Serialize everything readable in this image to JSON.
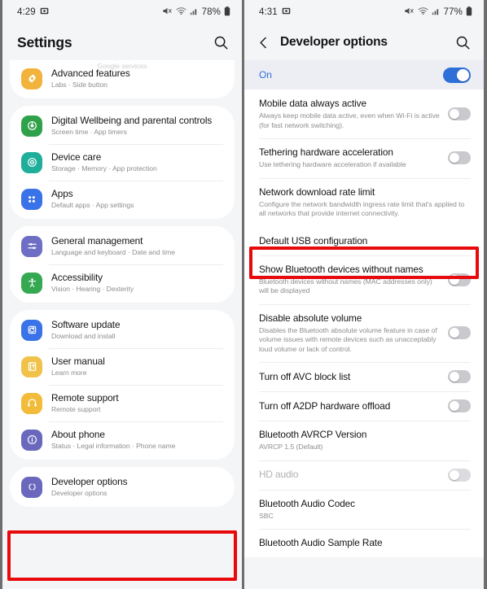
{
  "left": {
    "status": {
      "time": "4:29",
      "battery": "78%",
      "icons": [
        "mute-icon",
        "wifi-icon",
        "signal-icon",
        "battery-icon",
        "screenshot-icon"
      ]
    },
    "header": {
      "title": "Settings",
      "search_icon": "search-icon"
    },
    "ghost_item": "Google services",
    "groups": [
      {
        "clipped": true,
        "items": [
          {
            "title": "Advanced features",
            "sub": "Labs  ·  Side button",
            "icon": "advanced-features-icon",
            "color": "#f2b33d"
          }
        ]
      },
      {
        "clipped": false,
        "items": [
          {
            "title": "Digital Wellbeing and parental controls",
            "sub": "Screen time  ·  App timers",
            "icon": "digital-wellbeing-icon",
            "color": "#2fa14a"
          },
          {
            "title": "Device care",
            "sub": "Storage  ·  Memory  ·  App protection",
            "icon": "device-care-icon",
            "color": "#1fae9a"
          },
          {
            "title": "Apps",
            "sub": "Default apps  ·  App settings",
            "icon": "apps-icon",
            "color": "#3a72e8"
          }
        ]
      },
      {
        "clipped": false,
        "items": [
          {
            "title": "General management",
            "sub": "Language and keyboard  ·  Date and time",
            "icon": "general-management-icon",
            "color": "#6e6ec4"
          },
          {
            "title": "Accessibility",
            "sub": "Vision  ·  Hearing  ·  Dexterity",
            "icon": "accessibility-icon",
            "color": "#35a852"
          }
        ]
      },
      {
        "clipped": false,
        "items": [
          {
            "title": "Software update",
            "sub": "Download and install",
            "icon": "software-update-icon",
            "color": "#3a72e8"
          },
          {
            "title": "User manual",
            "sub": "Learn more",
            "icon": "user-manual-icon",
            "color": "#f0c24a"
          },
          {
            "title": "Remote support",
            "sub": "Remote support",
            "icon": "remote-support-icon",
            "color": "#f2bb3a"
          },
          {
            "title": "About phone",
            "sub": "Status  ·  Legal information  ·  Phone name",
            "icon": "about-phone-icon",
            "color": "#6a68bd"
          }
        ]
      },
      {
        "clipped": false,
        "items": [
          {
            "title": "Developer options",
            "sub": "Developer options",
            "icon": "developer-options-icon",
            "color": "#6a68bd"
          }
        ]
      }
    ],
    "highlight_color": "#e8090c"
  },
  "right": {
    "status": {
      "time": "4:31",
      "battery": "77%"
    },
    "header": {
      "title": "Developer options",
      "back_icon": "back-arrow-icon",
      "search_icon": "search-icon"
    },
    "master_switch": {
      "label": "On",
      "state": "on"
    },
    "items": [
      {
        "title": "Mobile data always active",
        "sub": "Always keep mobile data active, even when Wi-Fi is active (for fast network switching).",
        "toggle": "off"
      },
      {
        "title": "Tethering hardware acceleration",
        "sub": "Use tethering hardware acceleration if available",
        "toggle": "off"
      },
      {
        "title": "Network download rate limit",
        "sub": "Configure the network bandwidth ingress rate limit that's applied to all networks that provide internet connectivity.",
        "toggle": "none"
      },
      {
        "title": "Default USB configuration",
        "sub": "",
        "toggle": "none",
        "highlighted": true
      },
      {
        "title": "Show Bluetooth devices without names",
        "sub": "Bluetooth devices without names (MAC addresses only) will be displayed",
        "toggle": "off"
      },
      {
        "title": "Disable absolute volume",
        "sub": "Disables the Bluetooth absolute volume feature in case of volume issues with remote devices such as unacceptably loud volume or lack of control.",
        "toggle": "off"
      },
      {
        "title": "Turn off AVC block list",
        "sub": "",
        "toggle": "off"
      },
      {
        "title": "Turn off A2DP hardware offload",
        "sub": "",
        "toggle": "off"
      },
      {
        "title": "Bluetooth AVRCP Version",
        "sub": "AVRCP 1.5 (Default)",
        "toggle": "none"
      },
      {
        "title": "HD audio",
        "sub": "",
        "toggle": "off",
        "dim": true
      },
      {
        "title": "Bluetooth Audio Codec",
        "sub": "SBC",
        "toggle": "none"
      },
      {
        "title": "Bluetooth Audio Sample Rate",
        "sub": "",
        "toggle": "none",
        "cutoff": true
      }
    ],
    "highlight_color": "#e8090c"
  }
}
